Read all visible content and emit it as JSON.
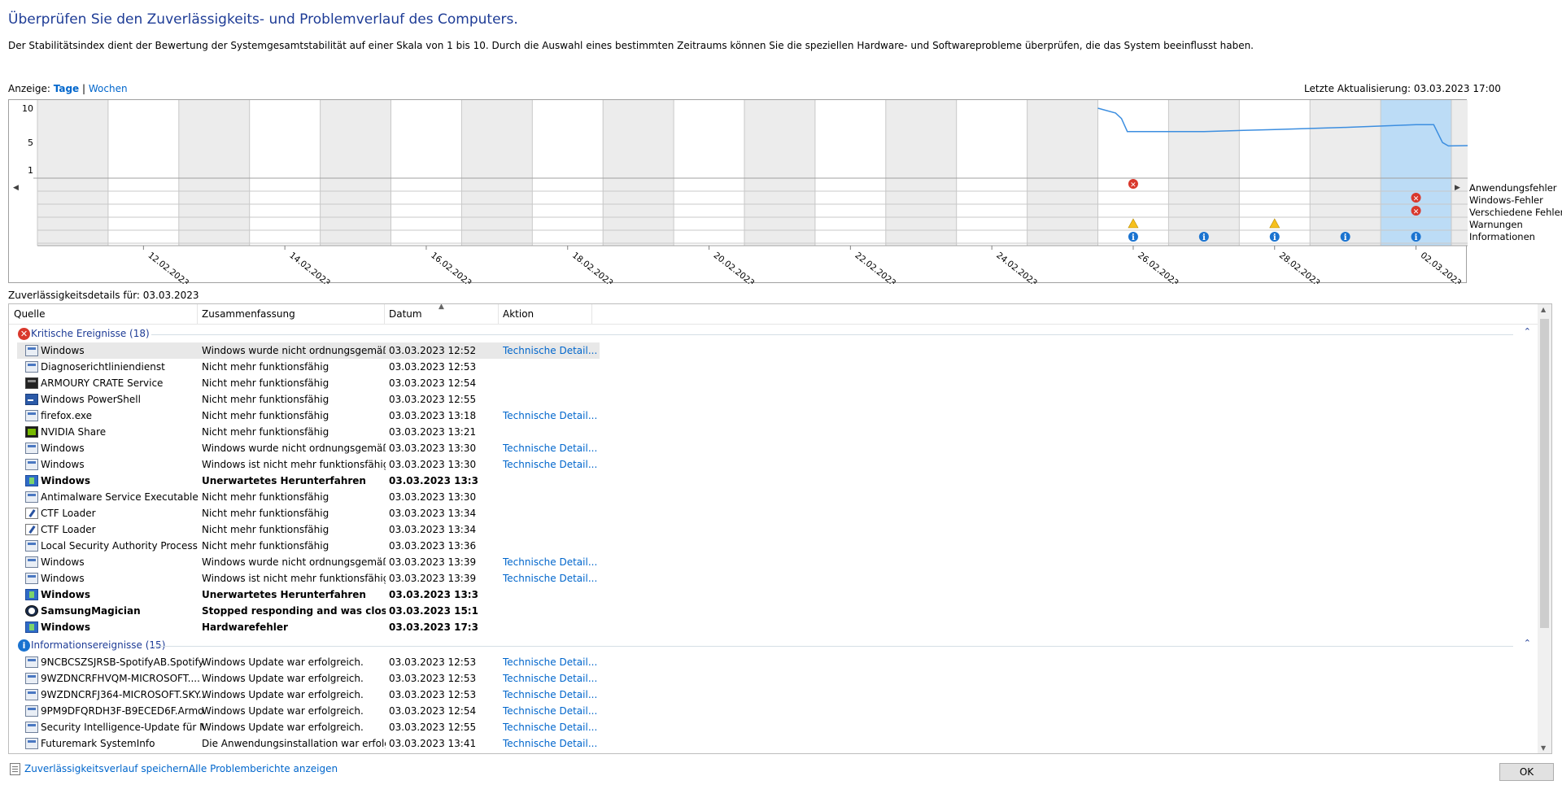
{
  "title": "Überprüfen Sie den Zuverlässigkeits- und Problemverlauf des Computers.",
  "description": "Der Stabilitätsindex dient der Bewertung der Systemgesamtstabilität auf einer Skala von 1 bis 10. Durch die Auswahl eines bestimmten Zeitraums können Sie die speziellen Hardware- und Softwareprobleme überprüfen, die das System beeinflusst haben.",
  "view": {
    "label": "Anzeige:",
    "days": "Tage",
    "separator": "|",
    "weeks": "Wochen"
  },
  "last_updated": "Letzte Aktualisierung: 03.03.2023 17:00",
  "chart": {
    "y_ticks": [
      "10",
      "5",
      "1"
    ],
    "date_labels": [
      "12.02.2023",
      "14.02.2023",
      "16.02.2023",
      "18.02.2023",
      "20.02.2023",
      "22.02.2023",
      "24.02.2023",
      "26.02.2023",
      "28.02.2023",
      "02.03.2023"
    ],
    "legend": [
      "Anwendungsfehler",
      "Windows-Fehler",
      "Verschiedene Fehler",
      "Warnungen",
      "Informationen"
    ],
    "selected_day_index": 19,
    "colors": {
      "line": "#3c8ee0",
      "selected": "#bcdcf6",
      "shaded": "#ececec",
      "error": "#d9382c",
      "warning": "#f6c01d",
      "info": "#1a73d0"
    }
  },
  "chart_data": {
    "type": "line",
    "x": [
      "11.02.2023",
      "12.02.2023",
      "13.02.2023",
      "14.02.2023",
      "15.02.2023",
      "16.02.2023",
      "17.02.2023",
      "18.02.2023",
      "19.02.2023",
      "20.02.2023",
      "21.02.2023",
      "22.02.2023",
      "23.02.2023",
      "24.02.2023",
      "25.02.2023",
      "26.02.2023",
      "27.02.2023",
      "28.02.2023",
      "01.03.2023",
      "02.03.2023",
      "03.03.2023"
    ],
    "series": [
      {
        "points": [
          [
            "26.02.2023 00:00",
            10
          ],
          [
            "26.02.2023 06:00",
            9.3
          ],
          [
            "26.02.2023 08:00",
            8.5
          ],
          [
            "26.02.2023 10:00",
            6.6
          ],
          [
            "27.02.2023 12:00",
            6.6
          ],
          [
            "28.02.2023 12:00",
            6.9
          ],
          [
            "01.03.2023 12:00",
            7.2
          ],
          [
            "02.03.2023 12:00",
            7.6
          ],
          [
            "02.03.2023 18:00",
            7.6
          ],
          [
            "02.03.2023 21:00",
            5.0
          ],
          [
            "02.03.2023 23:00",
            4.5
          ],
          [
            "03.03.2023 12:00",
            4.6
          ],
          [
            "03.03.2023 13:00",
            4.6
          ],
          [
            "03.03.2023 15:00",
            2.3
          ],
          [
            "03.03.2023 17:00",
            1.2
          ]
        ]
      }
    ],
    "ylim": [
      1,
      10
    ],
    "events": {
      "Anwendungsfehler": [
        "26.02.2023",
        "03.03.2023"
      ],
      "Windows-Fehler": [
        "02.03.2023",
        "03.03.2023"
      ],
      "Verschiedene Fehler": [
        "02.03.2023",
        "03.03.2023"
      ],
      "Warnungen": [
        "26.02.2023",
        "28.02.2023"
      ],
      "Informationen": [
        "26.02.2023",
        "27.02.2023",
        "28.02.2023",
        "01.03.2023",
        "02.03.2023",
        "03.03.2023"
      ]
    }
  },
  "details_label": "Zuverlässigkeitsdetails für: 03.03.2023",
  "columns": [
    "Quelle",
    "Zusammenfassung",
    "Datum",
    "Aktion"
  ],
  "groups": [
    {
      "label": "Kritische Ereignisse (18)",
      "icon": "error-icon",
      "rows": [
        {
          "icon": "window",
          "source": "Windows",
          "summary": "Windows wurde nicht ordnungsgemäß ...",
          "date": "03.03.2023 12:52",
          "action": "Technische Detail...",
          "selected": true
        },
        {
          "icon": "window",
          "source": "Diagnoserichtliniendienst",
          "summary": "Nicht mehr funktionsfähig",
          "date": "03.03.2023 12:53",
          "action": ""
        },
        {
          "icon": "dark",
          "source": "ARMOURY CRATE Service",
          "summary": "Nicht mehr funktionsfähig",
          "date": "03.03.2023 12:54",
          "action": ""
        },
        {
          "icon": "ps",
          "source": "Windows PowerShell",
          "summary": "Nicht mehr funktionsfähig",
          "date": "03.03.2023 12:55",
          "action": ""
        },
        {
          "icon": "window",
          "source": "firefox.exe",
          "summary": "Nicht mehr funktionsfähig",
          "date": "03.03.2023 13:18",
          "action": "Technische Detail..."
        },
        {
          "icon": "green",
          "source": "NVIDIA Share",
          "summary": "Nicht mehr funktionsfähig",
          "date": "03.03.2023 13:21",
          "action": ""
        },
        {
          "icon": "window",
          "source": "Windows",
          "summary": "Windows wurde nicht ordnungsgemäß ...",
          "date": "03.03.2023 13:30",
          "action": "Technische Detail..."
        },
        {
          "icon": "window",
          "source": "Windows",
          "summary": "Windows ist nicht mehr funktionsfähig.",
          "date": "03.03.2023 13:30",
          "action": "Technische Detail..."
        },
        {
          "icon": "shield",
          "source": "Windows",
          "summary": "Unerwartetes Herunterfahren",
          "date": "03.03.2023 13:30",
          "action": "",
          "bold": true
        },
        {
          "icon": "window",
          "source": "Antimalware Service Executable",
          "summary": "Nicht mehr funktionsfähig",
          "date": "03.03.2023 13:30",
          "action": ""
        },
        {
          "icon": "pen",
          "source": "CTF Loader",
          "summary": "Nicht mehr funktionsfähig",
          "date": "03.03.2023 13:34",
          "action": ""
        },
        {
          "icon": "pen",
          "source": "CTF Loader",
          "summary": "Nicht mehr funktionsfähig",
          "date": "03.03.2023 13:34",
          "action": ""
        },
        {
          "icon": "window",
          "source": "Local Security Authority Process",
          "summary": "Nicht mehr funktionsfähig",
          "date": "03.03.2023 13:36",
          "action": ""
        },
        {
          "icon": "window",
          "source": "Windows",
          "summary": "Windows wurde nicht ordnungsgemäß ...",
          "date": "03.03.2023 13:39",
          "action": "Technische Detail..."
        },
        {
          "icon": "window",
          "source": "Windows",
          "summary": "Windows ist nicht mehr funktionsfähig.",
          "date": "03.03.2023 13:39",
          "action": "Technische Detail..."
        },
        {
          "icon": "shield",
          "source": "Windows",
          "summary": "Unerwartetes Herunterfahren",
          "date": "03.03.2023 13:39",
          "action": "",
          "bold": true
        },
        {
          "icon": "ss",
          "source": "SamsungMagician",
          "summary": "Stopped responding and was closed",
          "date": "03.03.2023 15:10",
          "action": "",
          "bold": true
        },
        {
          "icon": "shield",
          "source": "Windows",
          "summary": "Hardwarefehler",
          "date": "03.03.2023 17:39",
          "action": "",
          "bold": true
        }
      ]
    },
    {
      "label": "Informationsereignisse (15)",
      "icon": "info-icon",
      "rows": [
        {
          "icon": "window",
          "source": "9NCBCSZSJRSB-SpotifyAB.Spotify...",
          "summary": "Windows Update war erfolgreich.",
          "date": "03.03.2023 12:53",
          "action": "Technische Detail..."
        },
        {
          "icon": "window",
          "source": "9WZDNCRFHVQM-MICROSOFT....",
          "summary": "Windows Update war erfolgreich.",
          "date": "03.03.2023 12:53",
          "action": "Technische Detail..."
        },
        {
          "icon": "window",
          "source": "9WZDNCRFJ364-MICROSOFT.SKY...",
          "summary": "Windows Update war erfolgreich.",
          "date": "03.03.2023 12:53",
          "action": "Technische Detail..."
        },
        {
          "icon": "window",
          "source": "9PM9DFQRDH3F-B9ECED6F.Armo...",
          "summary": "Windows Update war erfolgreich.",
          "date": "03.03.2023 12:54",
          "action": "Technische Detail..."
        },
        {
          "icon": "window",
          "source": "Security Intelligence-Update für M...",
          "summary": "Windows Update war erfolgreich.",
          "date": "03.03.2023 12:55",
          "action": "Technische Detail..."
        },
        {
          "icon": "window",
          "source": "Futuremark SystemInfo",
          "summary": "Die Anwendungsinstallation war erfolgr...",
          "date": "03.03.2023 13:41",
          "action": "Technische Detail..."
        }
      ]
    }
  ],
  "footer": {
    "save_link": "Zuverlässigkeitsverlauf speichern...",
    "reports_link": "Alle Problemberichte anzeigen",
    "ok": "OK"
  }
}
